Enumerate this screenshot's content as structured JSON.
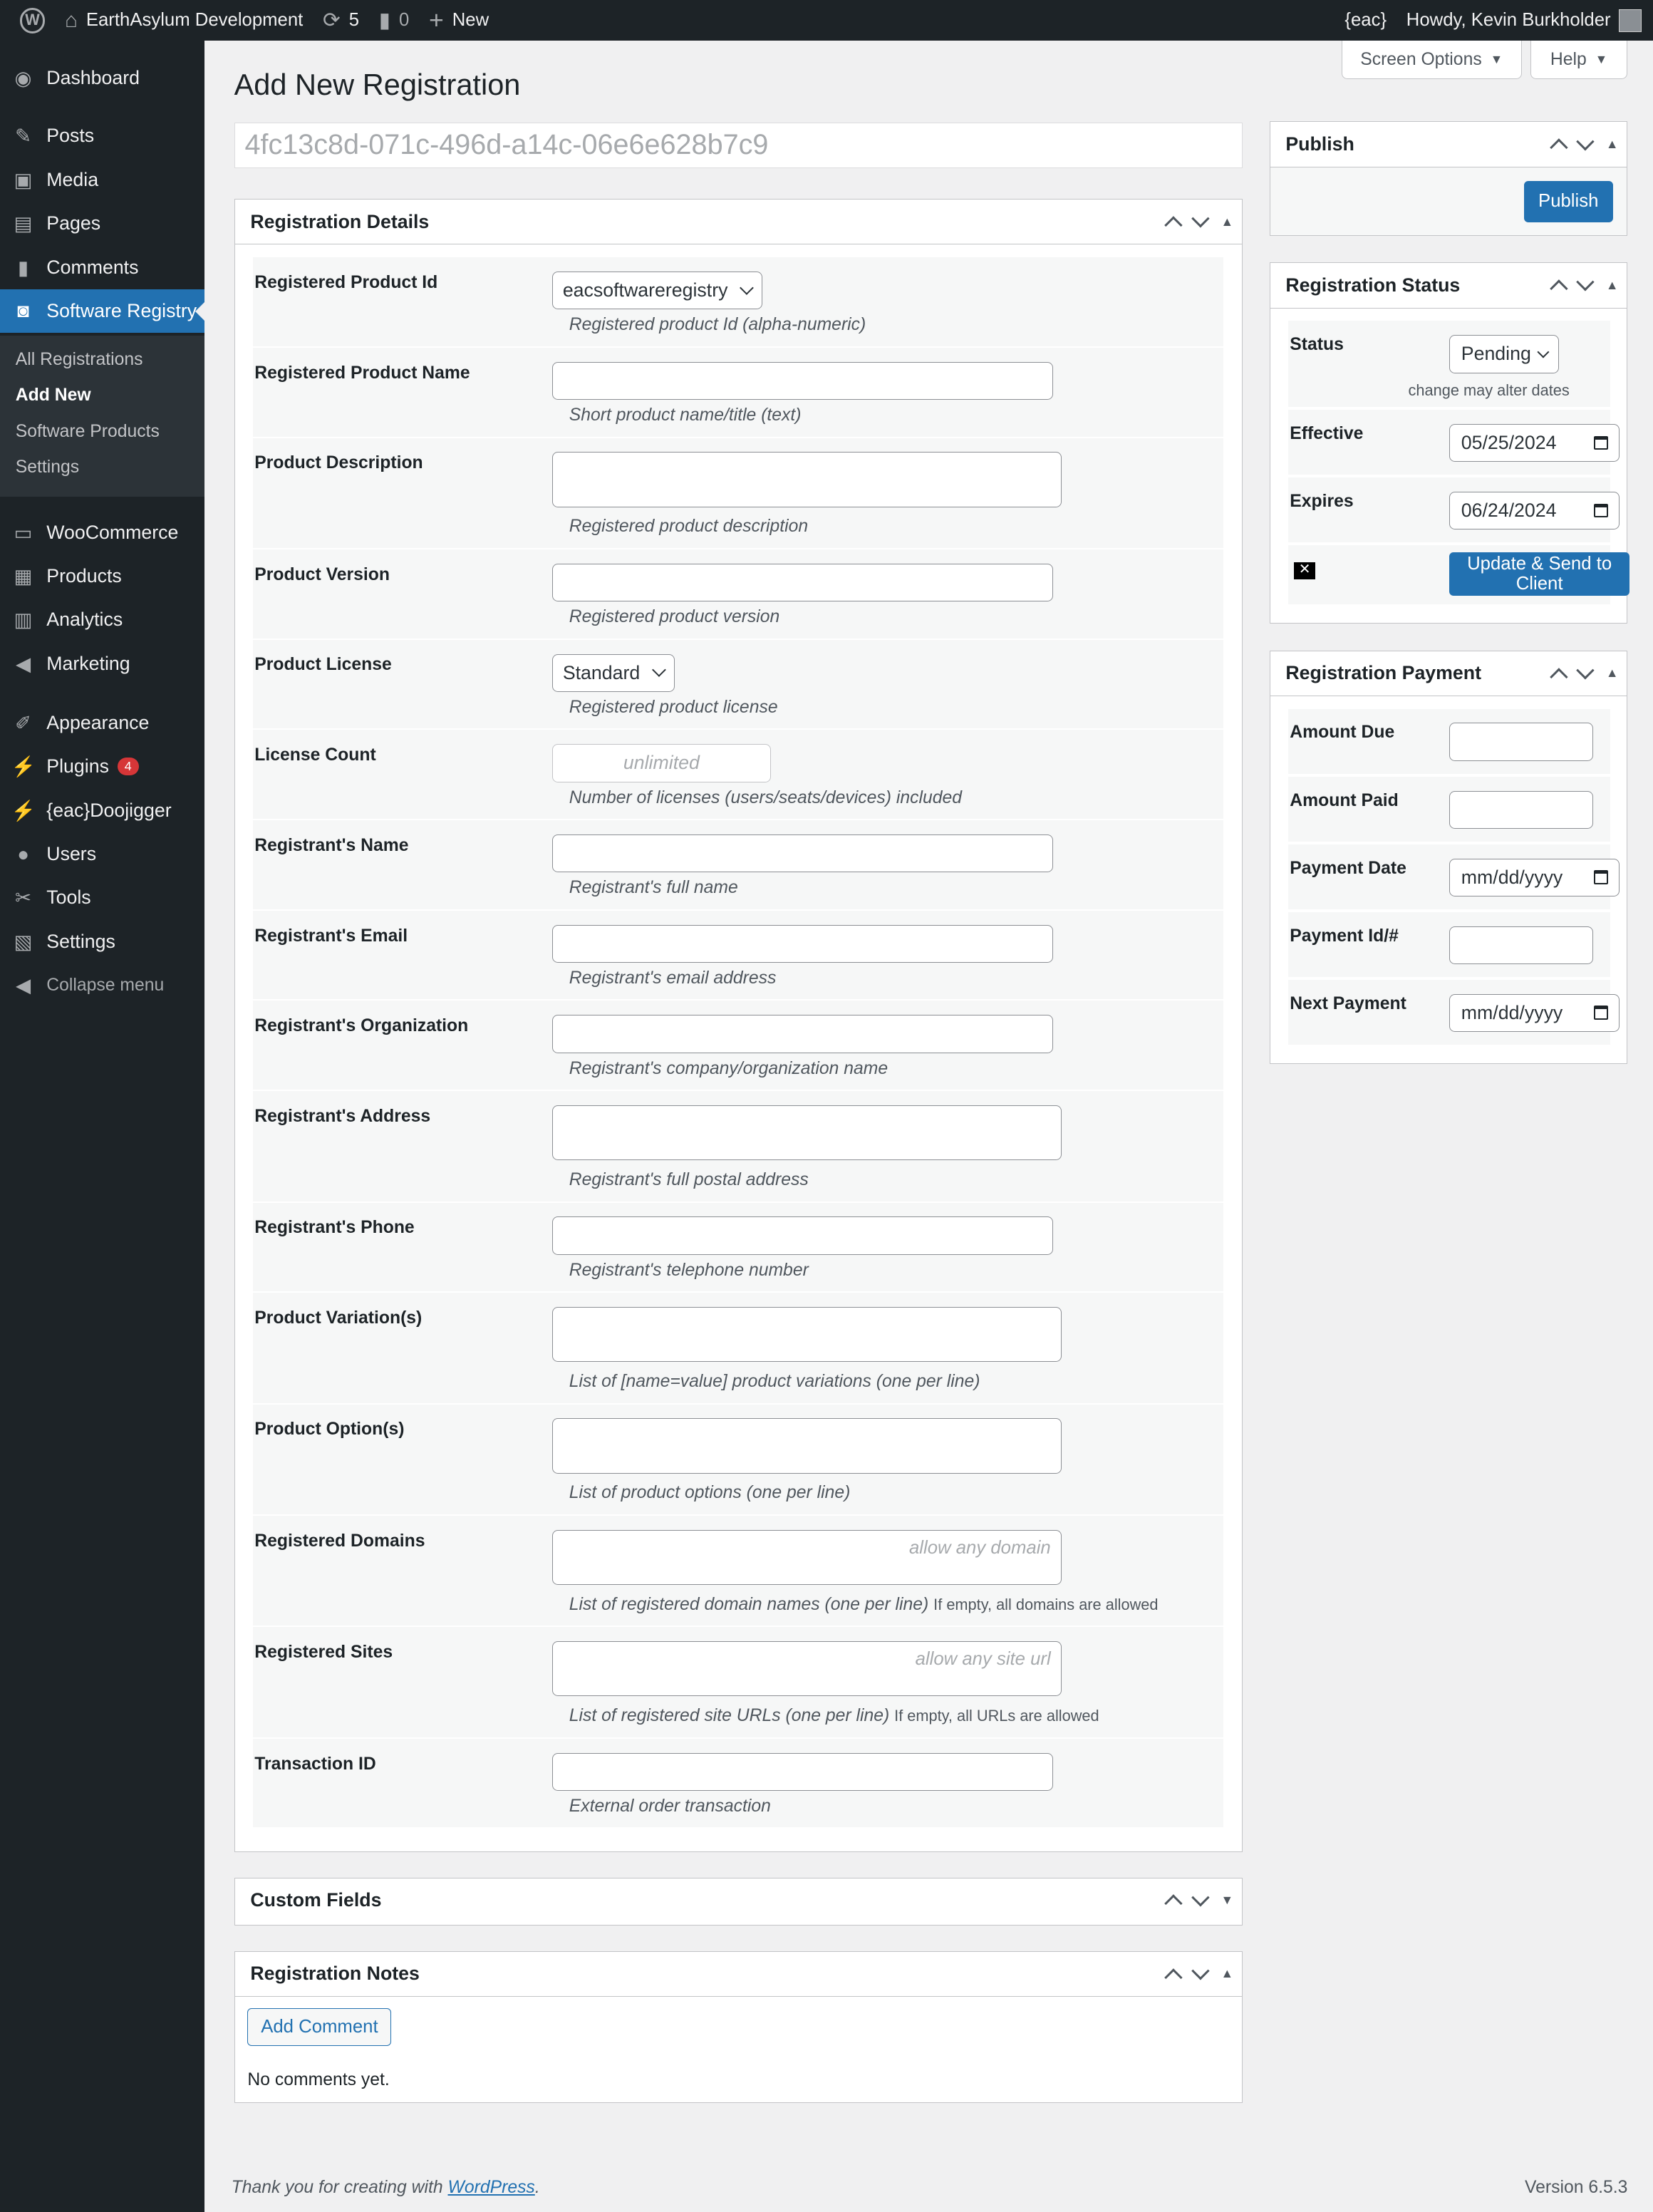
{
  "admin_bar": {
    "site_name": "EarthAsylum Development",
    "updates": "5",
    "comments": "0",
    "new_label": "New",
    "eac": "{eac}",
    "howdy": "Howdy, Kevin Burkholder"
  },
  "sidebar": {
    "items": [
      {
        "label": "Dashboard",
        "icon": "dashboard-icon"
      },
      {
        "label": "Posts",
        "icon": "pin-icon"
      },
      {
        "label": "Media",
        "icon": "media-icon"
      },
      {
        "label": "Pages",
        "icon": "pages-icon"
      },
      {
        "label": "Comments",
        "icon": "comment-icon"
      },
      {
        "label": "Software Registry",
        "icon": "registry-icon",
        "active": true
      },
      {
        "label": "WooCommerce",
        "icon": "woo-icon"
      },
      {
        "label": "Products",
        "icon": "products-icon"
      },
      {
        "label": "Analytics",
        "icon": "chart-icon"
      },
      {
        "label": "Marketing",
        "icon": "megaphone-icon"
      },
      {
        "label": "Appearance",
        "icon": "brush-icon"
      },
      {
        "label": "Plugins",
        "icon": "plugin-icon",
        "badge": "4"
      },
      {
        "label": "{eac}Doojigger",
        "icon": "plugin-icon"
      },
      {
        "label": "Users",
        "icon": "user-icon"
      },
      {
        "label": "Tools",
        "icon": "wrench-icon"
      },
      {
        "label": "Settings",
        "icon": "settings-icon"
      }
    ],
    "submenu": [
      "All Registrations",
      "Add New",
      "Software Products",
      "Settings"
    ],
    "current_sub": "Add New",
    "collapse": "Collapse menu"
  },
  "screen_options": "Screen Options",
  "help": "Help",
  "page_title": "Add New Registration",
  "title_value": "4fc13c8d-071c-496d-a14c-06e6e628b7c9",
  "details": {
    "title": "Registration Details",
    "fields": [
      {
        "label": "Registered Product Id",
        "type": "select",
        "value": "eacsoftwareregistry",
        "desc": "Registered product Id (alpha-numeric)"
      },
      {
        "label": "Registered Product Name",
        "type": "text",
        "value": "",
        "desc": "Short product name/title (text)"
      },
      {
        "label": "Product Description",
        "type": "textarea",
        "value": "",
        "desc": "Registered product description"
      },
      {
        "label": "Product Version",
        "type": "text",
        "value": "",
        "desc": "Registered product version"
      },
      {
        "label": "Product License",
        "type": "select",
        "value": "Standard",
        "desc": "Registered product license"
      },
      {
        "label": "License Count",
        "type": "placeholder",
        "placeholder": "unlimited",
        "desc": "Number of licenses (users/seats/devices) included"
      },
      {
        "label": "Registrant's Name",
        "type": "text",
        "value": "",
        "desc": "Registrant's full name"
      },
      {
        "label": "Registrant's Email",
        "type": "text",
        "value": "",
        "desc": "Registrant's email address"
      },
      {
        "label": "Registrant's Organization",
        "type": "text",
        "value": "",
        "desc": "Registrant's company/organization name"
      },
      {
        "label": "Registrant's Address",
        "type": "textarea",
        "value": "",
        "desc": "Registrant's full postal address"
      },
      {
        "label": "Registrant's Phone",
        "type": "text",
        "value": "",
        "desc": "Registrant's telephone number"
      },
      {
        "label": "Product Variation(s)",
        "type": "textarea",
        "value": "",
        "desc": "List of [name=value] product variations (one per line)"
      },
      {
        "label": "Product Option(s)",
        "type": "textarea",
        "value": "",
        "desc": "List of product options (one per line)"
      },
      {
        "label": "Registered Domains",
        "type": "textarea",
        "placeholder": "allow any domain",
        "desc": "List of registered domain names (one per line)",
        "note": "If empty, all domains are allowed"
      },
      {
        "label": "Registered Sites",
        "type": "textarea",
        "placeholder": "allow any site url",
        "desc": "List of registered site URLs (one per line)",
        "note": "If empty, all URLs are allowed"
      },
      {
        "label": "Transaction ID",
        "type": "text",
        "value": "",
        "desc": "External order transaction"
      }
    ]
  },
  "custom_fields": {
    "title": "Custom Fields"
  },
  "notes": {
    "title": "Registration Notes",
    "add_comment": "Add Comment",
    "empty": "No comments yet."
  },
  "publish": {
    "title": "Publish",
    "button": "Publish"
  },
  "status": {
    "title": "Registration Status",
    "status_label": "Status",
    "status_value": "Pending",
    "status_note": "change may alter dates",
    "effective_label": "Effective",
    "effective_value": "05/25/2024",
    "expires_label": "Expires",
    "expires_value": "06/24/2024",
    "send_button": "Update & Send to Client"
  },
  "payment": {
    "title": "Registration Payment",
    "fields": [
      {
        "label": "Amount Due",
        "type": "text",
        "value": ""
      },
      {
        "label": "Amount Paid",
        "type": "text",
        "value": ""
      },
      {
        "label": "Payment Date",
        "type": "date",
        "value": "mm/dd/yyyy"
      },
      {
        "label": "Payment Id/#",
        "type": "text",
        "value": ""
      },
      {
        "label": "Next Payment",
        "type": "date",
        "value": "mm/dd/yyyy"
      }
    ]
  },
  "footer": {
    "thanks": "Thank you for creating with",
    "link": "WordPress",
    "version": "Version 6.5.3"
  },
  "colors": {
    "accent": "#2271b1",
    "sidebar": "#1d2327",
    "badge": "#d63638"
  }
}
